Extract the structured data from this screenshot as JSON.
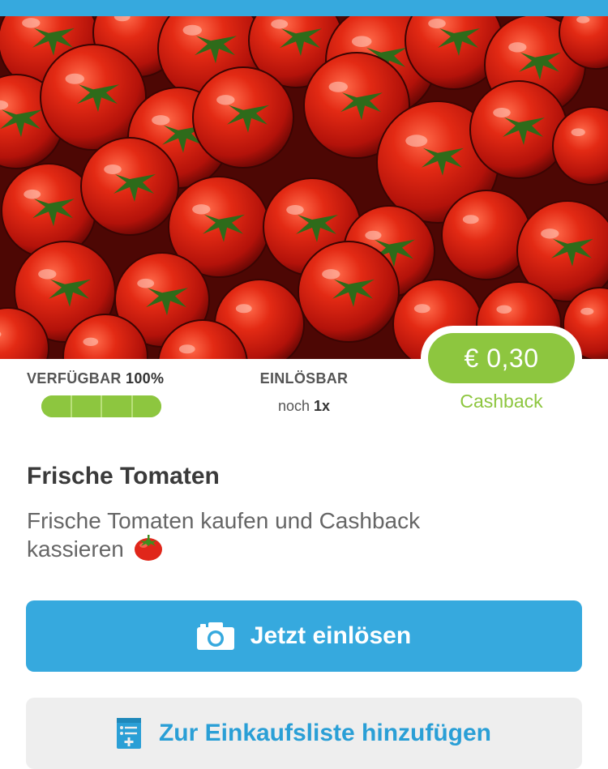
{
  "colors": {
    "accent_blue": "#36a9de",
    "cashback_green": "#8dc63f",
    "secondary_bg": "#eeeeee"
  },
  "offer": {
    "cashback_amount": "€ 0,30",
    "cashback_label": "Cashback",
    "availability_label": "VERFÜGBAR",
    "availability_percent": "100%",
    "availability_fraction": 1.0,
    "redeemable_label": "EINLÖSBAR",
    "redeemable_prefix": "noch",
    "redeemable_count": "1x",
    "title": "Frische Tomaten",
    "description": "Frische Tomaten kaufen und Cashback kassieren"
  },
  "actions": {
    "redeem_label": "Jetzt einlösen",
    "redeem_icon": "camera-icon",
    "add_to_list_label": "Zur Einkaufsliste hinzufügen",
    "add_to_list_icon": "shopping-list-add-icon"
  }
}
